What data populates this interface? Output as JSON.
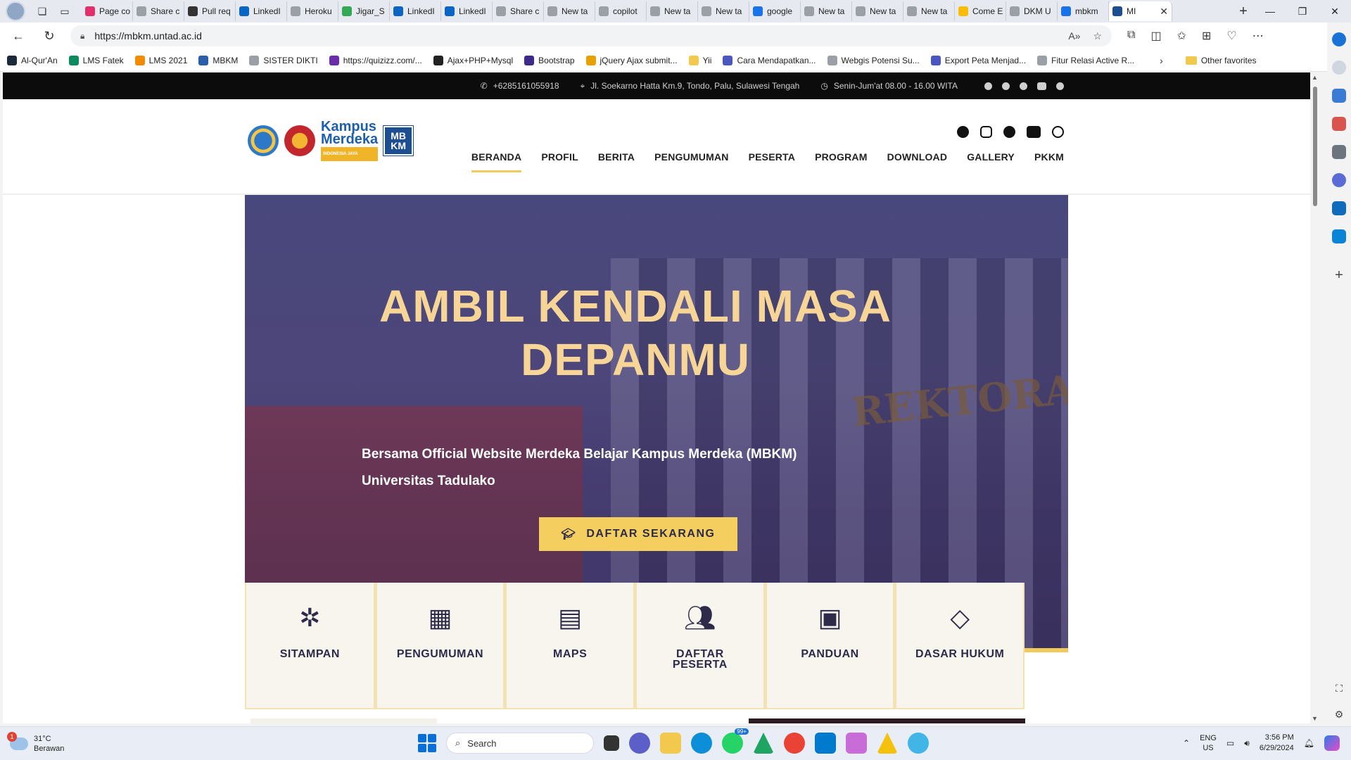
{
  "browser": {
    "tabs": [
      {
        "label": "Page co",
        "color": "#e1306c"
      },
      {
        "label": "Share c",
        "color": "#9aa0a6"
      },
      {
        "label": "Pull req",
        "color": "#333333"
      },
      {
        "label": "LinkedI",
        "color": "#0a66c2"
      },
      {
        "label": "Heroku",
        "color": "#9aa0a6"
      },
      {
        "label": "Jigar_S",
        "color": "#34a853"
      },
      {
        "label": "LinkedI",
        "color": "#0a66c2"
      },
      {
        "label": "LinkedI",
        "color": "#0a66c2"
      },
      {
        "label": "Share c",
        "color": "#9aa0a6"
      },
      {
        "label": "New ta",
        "color": "#9aa0a6"
      },
      {
        "label": "copilot",
        "color": "#9aa0a6"
      },
      {
        "label": "New ta",
        "color": "#9aa0a6"
      },
      {
        "label": "New ta",
        "color": "#9aa0a6"
      },
      {
        "label": "google",
        "color": "#1a73e8"
      },
      {
        "label": "New ta",
        "color": "#9aa0a6"
      },
      {
        "label": "New ta",
        "color": "#9aa0a6"
      },
      {
        "label": "New ta",
        "color": "#9aa0a6"
      },
      {
        "label": "Come E",
        "color": "#fbbc04"
      },
      {
        "label": "DKM U",
        "color": "#9aa0a6"
      },
      {
        "label": "mbkm",
        "color": "#1a73e8"
      }
    ],
    "active_tab": "MI",
    "url": "https://mbkm.untad.ac.id",
    "bookmarks": [
      {
        "label": "Al-Qur'An",
        "color": "#1b2a3a"
      },
      {
        "label": "LMS Fatek",
        "color": "#0e8a5f"
      },
      {
        "label": "LMS 2021",
        "color": "#f28b00"
      },
      {
        "label": "MBKM",
        "color": "#2b5ea8"
      },
      {
        "label": "SISTER DIKTI",
        "color": "#9aa0a6"
      },
      {
        "label": "https://quizizz.com/...",
        "color": "#6c2da8"
      },
      {
        "label": "Ajax+PHP+Mysql",
        "color": "#222222"
      },
      {
        "label": "Bootstrap",
        "color": "#3d2a8a"
      },
      {
        "label": "jQuery Ajax submit...",
        "color": "#e8a100"
      },
      {
        "label": "Yii",
        "color": "#f2c94c"
      },
      {
        "label": "Cara Mendapatkan...",
        "color": "#4a56c2"
      },
      {
        "label": "Webgis Potensi Su...",
        "color": "#9aa0a6"
      },
      {
        "label": "Export Peta Menjad...",
        "color": "#4a56c2"
      },
      {
        "label": "Fitur Relasi Active R...",
        "color": "#9aa0a6"
      }
    ],
    "other_favorites": "Other favorites"
  },
  "site": {
    "topbar": {
      "phone": "+6285161055918",
      "address": "Jl. Soekarno Hatta Km.9, Tondo, Palu, Sulawesi Tengah",
      "hours": "Senin-Jum'at 08.00 - 16.00 WITA"
    },
    "logo": {
      "km_line1": "Kampus",
      "km_line2": "Merdeka",
      "km_tag": "INDONESIA JAYA",
      "mbkm_line1": "MB",
      "mbkm_line2": "KM"
    },
    "nav": [
      "BERANDA",
      "PROFIL",
      "BERITA",
      "PENGUMUMAN",
      "PESERTA",
      "PROGRAM",
      "DOWNLOAD",
      "GALLERY",
      "PKKM"
    ],
    "hero": {
      "title_line1": "AMBIL KENDALI MASA",
      "title_line2": "DEPANMU",
      "subtitle_line1": "Bersama Official Website Merdeka Belajar Kampus Merdeka (MBKM)",
      "subtitle_line2": "Universitas Tadulako",
      "cta": "DAFTAR SEKARANG",
      "building_text": "REKTORA"
    },
    "features": [
      {
        "label": "SITAMPAN",
        "icon": "slack-icon"
      },
      {
        "label": "PENGUMUMAN",
        "icon": "building-icon"
      },
      {
        "label": "MAPS",
        "icon": "map-icon"
      },
      {
        "label": "DAFTAR PESERTA",
        "icon": "users-icon"
      },
      {
        "label": "PANDUAN",
        "icon": "book-icon"
      },
      {
        "label": "DASAR HUKUM",
        "icon": "gem-icon"
      }
    ],
    "colors": {
      "accent": "#f4cf5f",
      "hero_title": "#f7d596",
      "navy": "#2d2a4a"
    }
  },
  "taskbar": {
    "weather_temp": "31°C",
    "weather_desc": "Berawan",
    "weather_badge": "1",
    "search_placeholder": "Search",
    "whatsapp_badge": "99+",
    "lang": "ENG",
    "region": "US",
    "time": "3:56 PM",
    "date": "6/29/2024"
  }
}
